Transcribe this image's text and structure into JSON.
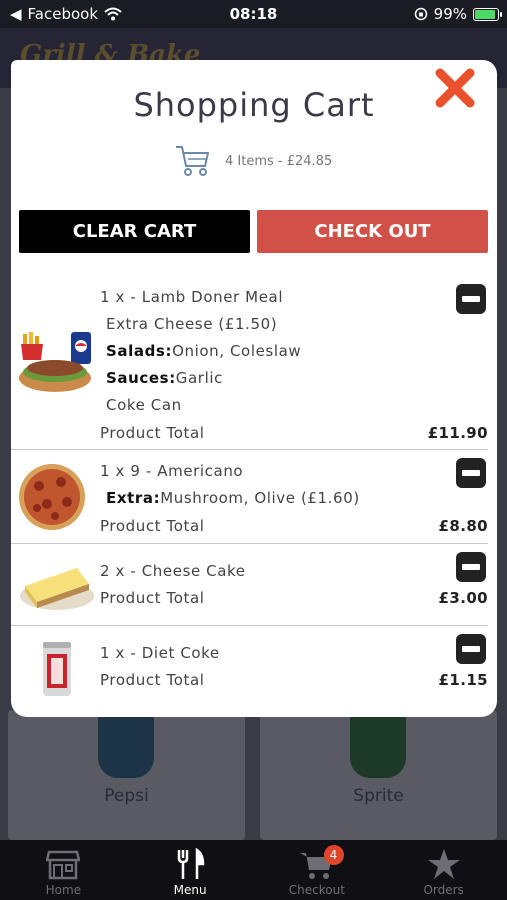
{
  "status_bar": {
    "back_app": "Facebook",
    "time": "08:18",
    "battery": "99%"
  },
  "background": {
    "brand": "Grill & Bake",
    "cards": [
      "Pepsi",
      "Sprite"
    ]
  },
  "modal": {
    "title": "Shopping Cart",
    "summary": "4 Items - £24.85",
    "clear_label": "CLEAR CART",
    "checkout_label": "CHECK OUT",
    "items": [
      {
        "name": "1 x - Lamb Doner Meal",
        "extra": "Extra Cheese (£1.50)",
        "salads_label": "Salads:",
        "salads": "Onion, Coleslaw",
        "sauces_label": "Sauces:",
        "sauces": "Garlic",
        "drink": "Coke Can",
        "total_label": "Product Total",
        "total": "£11.90"
      },
      {
        "name": "1 x 9 - Americano",
        "extra_label": "Extra:",
        "extra": "Mushroom, Olive (£1.60)",
        "total_label": "Product Total",
        "total": "£8.80"
      },
      {
        "name": "2 x - Cheese Cake",
        "total_label": "Product Total",
        "total": "£3.00"
      },
      {
        "name": "1 x - Diet Coke",
        "total_label": "Product Total",
        "total": "£1.15"
      }
    ]
  },
  "tabbar": {
    "tabs": [
      {
        "label": "Home",
        "icon": "store-icon"
      },
      {
        "label": "Menu",
        "icon": "fork-knife-icon"
      },
      {
        "label": "Checkout",
        "icon": "cart-icon",
        "badge": "4"
      },
      {
        "label": "Orders",
        "icon": "star-icon"
      }
    ]
  },
  "colors": {
    "accent_red": "#d15148",
    "close_orange": "#e8512b"
  }
}
